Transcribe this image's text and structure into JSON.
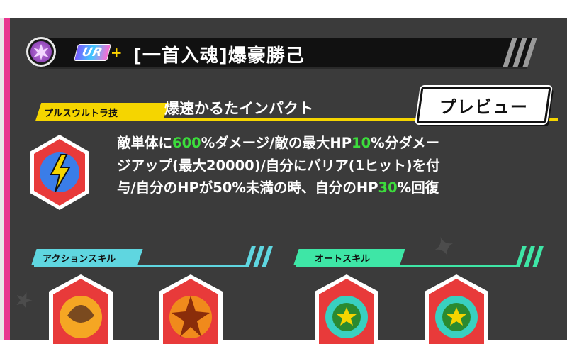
{
  "header": {
    "rank_badge": "UR",
    "rank_plus": "+",
    "character_name": "[一首入魂]爆豪勝己"
  },
  "special_move": {
    "category_label": "プルスウルトラ技",
    "name": "爆速かるたインパクト",
    "preview_button": "プレビュー",
    "description": {
      "line1": {
        "a": "敵単体に",
        "v1": "600",
        "b": "%ダメージ/敵の最大HP",
        "v2": "10",
        "c": "%分ダメー"
      },
      "line2": "ジアップ(最大20000)/自分にバリア(1ヒット)を付",
      "line3": {
        "a": "与/自分のHPが50%未満の時、自分のHP",
        "v": "30",
        "b": "%回復"
      }
    }
  },
  "action_skill": {
    "label": "アクションスキル"
  },
  "auto_skill": {
    "label": "オートスキル"
  },
  "colors": {
    "highlight": "#3cdc3c",
    "special_yellow": "#f5d500",
    "action_cyan": "#5fd6e0",
    "auto_green": "#3ee6a6",
    "accent_pink": "#e8368f"
  }
}
